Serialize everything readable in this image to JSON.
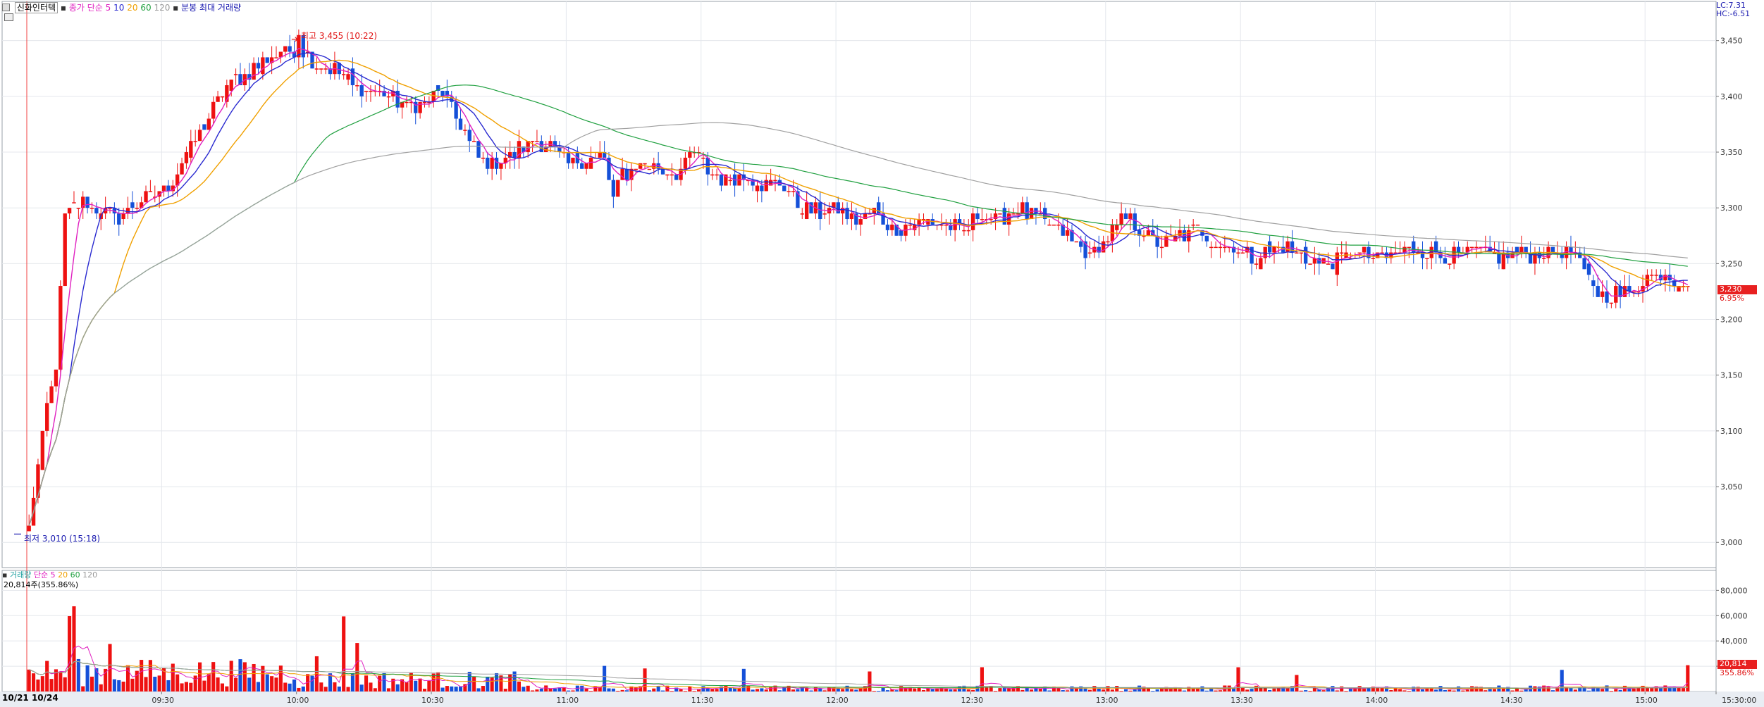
{
  "header": {
    "stock_name": "신화인터텍",
    "ma_label": "종가 단순",
    "ma_periods": [
      "5",
      "10",
      "20",
      "60",
      "120"
    ],
    "extra_label": "분봉 최대 거래량"
  },
  "volume_header": {
    "label": "거래량",
    "ma_label": "단순",
    "ma_periods": [
      "5",
      "20",
      "60",
      "120"
    ],
    "current_info": "20,814주(355.86%)"
  },
  "right_top": {
    "lc": "LC:7.31",
    "hc": "HC:-6.51"
  },
  "annotations": {
    "high": "최고 3,455 (10:22)",
    "low": "최저 3,010 (15:18)"
  },
  "current_price": {
    "price": "3,230",
    "change": "6.95%"
  },
  "current_volume": {
    "volume": "20,814",
    "ratio": "355.86%"
  },
  "date_label": "10/21 10/24",
  "colors": {
    "up": "#ee1111",
    "down": "#1550d8",
    "ma5": "#e020c0",
    "ma10": "#2a2ad0",
    "ma20": "#f0a000",
    "ma60": "#20a040",
    "ma120": "#a0a0a0"
  },
  "chart_data": [
    {
      "type": "candlestick",
      "title": "신화인터텍",
      "x_ticks": [
        "09:30",
        "10:00",
        "10:30",
        "11:00",
        "11:30",
        "12:00",
        "12:30",
        "13:00",
        "13:30",
        "14:00",
        "14:30",
        "15:00",
        "15:30:00"
      ],
      "y_ticks": [
        "3,450",
        "3,400",
        "3,350",
        "3,300",
        "3,250",
        "3,200",
        "3,150",
        "3,100",
        "3,050",
        "3,000"
      ],
      "ylim": [
        2985,
        3470
      ],
      "grid": true,
      "high": 3455,
      "low": 3010,
      "last": 3230,
      "close_path": [
        [
          0,
          3015
        ],
        [
          4,
          3120
        ],
        [
          6,
          3160
        ],
        [
          8,
          3290
        ],
        [
          10,
          3300
        ],
        [
          12,
          3305
        ],
        [
          14,
          3300
        ],
        [
          16,
          3300
        ],
        [
          20,
          3290
        ],
        [
          24,
          3305
        ],
        [
          28,
          3310
        ],
        [
          32,
          3325
        ],
        [
          36,
          3355
        ],
        [
          40,
          3380
        ],
        [
          44,
          3410
        ],
        [
          48,
          3420
        ],
        [
          52,
          3430
        ],
        [
          56,
          3440
        ],
        [
          60,
          3445
        ],
        [
          64,
          3430
        ],
        [
          68,
          3425
        ],
        [
          72,
          3410
        ],
        [
          76,
          3405
        ],
        [
          80,
          3400
        ],
        [
          84,
          3390
        ],
        [
          88,
          3395
        ],
        [
          92,
          3405
        ],
        [
          96,
          3375
        ],
        [
          100,
          3345
        ],
        [
          104,
          3340
        ],
        [
          108,
          3350
        ],
        [
          112,
          3360
        ],
        [
          116,
          3355
        ],
        [
          120,
          3340
        ],
        [
          124,
          3345
        ],
        [
          128,
          3345
        ],
        [
          130,
          3310
        ],
        [
          132,
          3330
        ],
        [
          136,
          3340
        ],
        [
          140,
          3335
        ],
        [
          144,
          3330
        ],
        [
          148,
          3350
        ],
        [
          152,
          3330
        ],
        [
          156,
          3325
        ],
        [
          160,
          3330
        ],
        [
          164,
          3320
        ],
        [
          168,
          3320
        ],
        [
          172,
          3300
        ],
        [
          176,
          3295
        ],
        [
          180,
          3300
        ],
        [
          184,
          3290
        ],
        [
          188,
          3295
        ],
        [
          192,
          3280
        ],
        [
          196,
          3285
        ],
        [
          200,
          3290
        ],
        [
          204,
          3285
        ],
        [
          208,
          3280
        ],
        [
          212,
          3295
        ],
        [
          216,
          3290
        ],
        [
          220,
          3300
        ],
        [
          224,
          3290
        ],
        [
          228,
          3285
        ],
        [
          232,
          3270
        ],
        [
          236,
          3255
        ],
        [
          240,
          3275
        ],
        [
          244,
          3290
        ],
        [
          248,
          3280
        ],
        [
          252,
          3265
        ],
        [
          256,
          3275
        ],
        [
          260,
          3280
        ],
        [
          264,
          3270
        ],
        [
          268,
          3265
        ],
        [
          272,
          3255
        ],
        [
          276,
          3260
        ],
        [
          280,
          3265
        ],
        [
          284,
          3255
        ],
        [
          288,
          3250
        ],
        [
          292,
          3255
        ],
        [
          296,
          3260
        ],
        [
          300,
          3255
        ],
        [
          304,
          3260
        ],
        [
          308,
          3265
        ],
        [
          312,
          3260
        ],
        [
          316,
          3255
        ],
        [
          320,
          3260
        ],
        [
          324,
          3260
        ],
        [
          328,
          3255
        ],
        [
          332,
          3260
        ],
        [
          336,
          3258
        ],
        [
          340,
          3262
        ],
        [
          344,
          3258
        ],
        [
          346,
          3240
        ],
        [
          348,
          3230
        ],
        [
          350,
          3220
        ],
        [
          352,
          3222
        ],
        [
          356,
          3225
        ],
        [
          358,
          3232
        ],
        [
          360,
          3240
        ],
        [
          362,
          3240
        ],
        [
          364,
          3245
        ],
        [
          366,
          3235
        ],
        [
          368,
          3238
        ]
      ],
      "series": [
        {
          "name": "5"
        },
        {
          "name": "10"
        },
        {
          "name": "20"
        },
        {
          "name": "60"
        },
        {
          "name": "120"
        }
      ]
    },
    {
      "type": "bar",
      "title": "거래량",
      "y_ticks": [
        "80,000",
        "60,000",
        "40,000",
        "20,000"
      ],
      "ylim": [
        0,
        88000
      ],
      "last": 20814
    }
  ]
}
